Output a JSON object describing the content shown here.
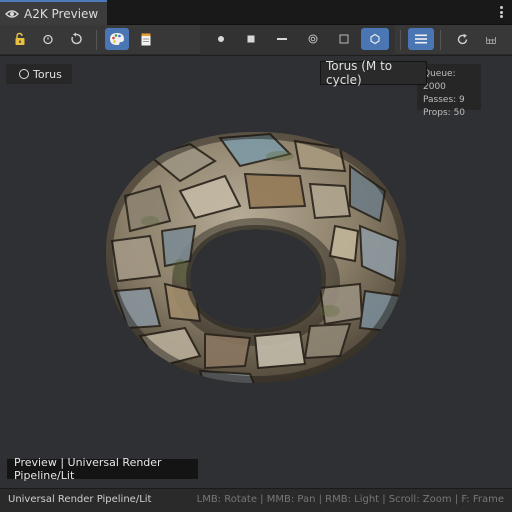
{
  "window": {
    "tab_title": "A2K Preview"
  },
  "toolbar": {
    "left_buttons": [
      "unlock-icon",
      "timer-icon",
      "reset-rotation-icon"
    ],
    "material_buttons": [
      "palette-icon",
      "document-icon"
    ],
    "mesh_buttons": [
      "sphere-icon",
      "cube-icon",
      "plane-icon",
      "capsule-icon",
      "quad-icon",
      "torus-icon"
    ],
    "active_mesh": "torus-icon",
    "right_buttons": [
      "menu-lines-icon",
      "refresh-icon",
      "grid-icon"
    ],
    "accent_color": "#4a76b4"
  },
  "viewport": {
    "mesh_label": "Torus",
    "tooltip": "Torus (M to cycle)",
    "stats": {
      "queue": "Queue: 2000",
      "passes": "Passes: 9",
      "props": "Props: 50"
    },
    "status_overlay": "Preview | Universal Render Pipeline/Lit"
  },
  "footer": {
    "shader": "Universal Render Pipeline/Lit",
    "hints": "LMB: Rotate | MMB: Pan | RMB: Light | Scroll: Zoom | F: Frame"
  }
}
